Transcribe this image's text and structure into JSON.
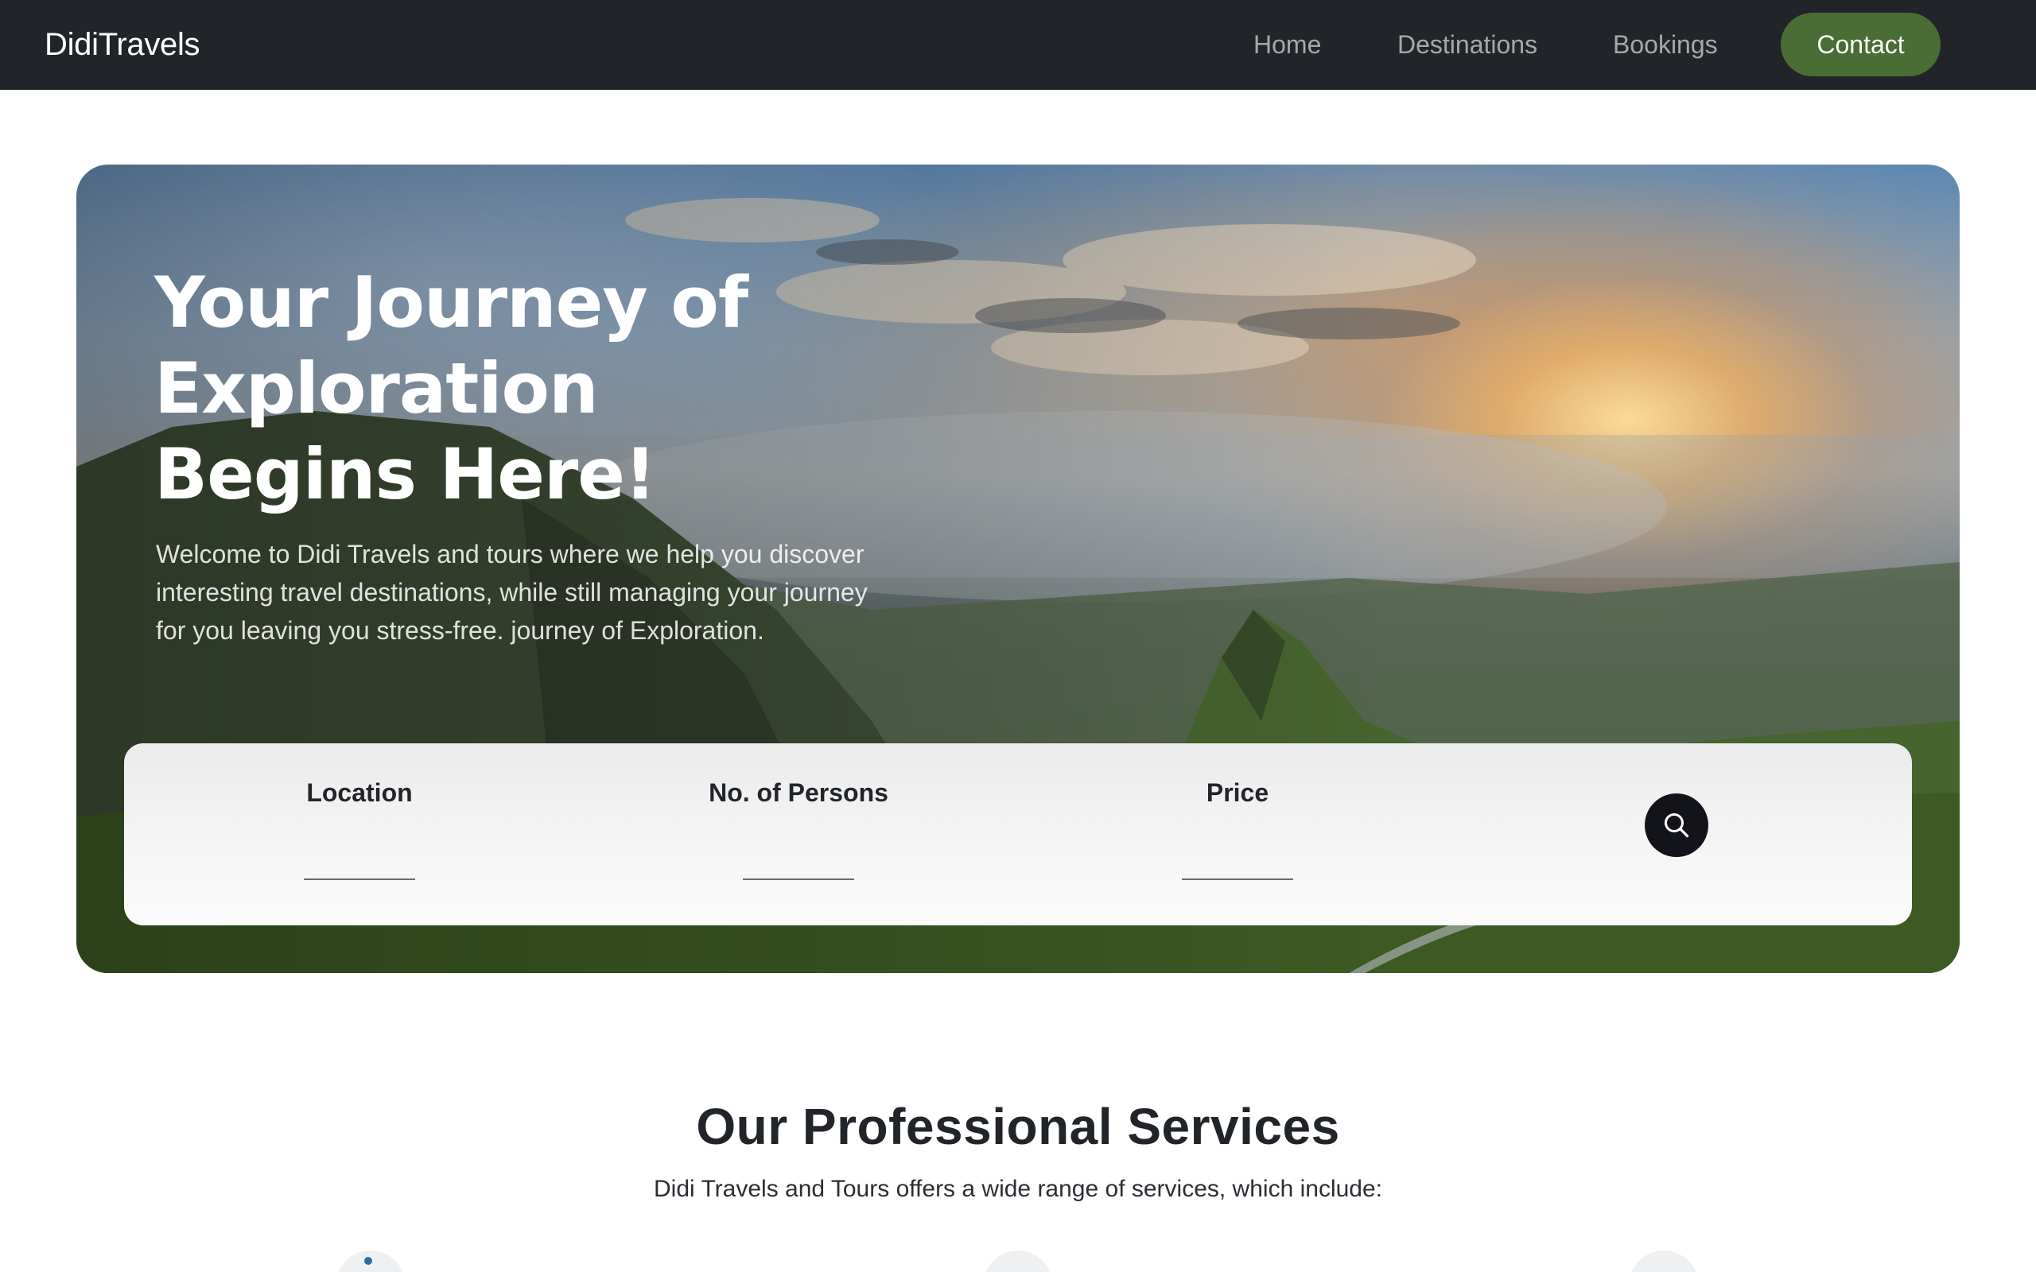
{
  "navbar": {
    "brand": "DidiTravels",
    "links": [
      "Home",
      "Destinations",
      "Bookings"
    ],
    "contact_label": "Contact",
    "colors": {
      "background": "#212529",
      "contact_button": "#4a6c35"
    }
  },
  "hero": {
    "title": "Your Journey of Exploration Begins Here!",
    "description": "Welcome to Didi Travels and tours where we help you discover interesting travel destinations, while still managing your journey for you leaving you stress-free. journey of Exploration."
  },
  "search": {
    "fields": [
      {
        "label": "Location",
        "value": ""
      },
      {
        "label": "No. of Persons",
        "value": ""
      },
      {
        "label": "Price",
        "value": ""
      }
    ],
    "button_icon": "search-icon"
  },
  "services": {
    "title": "Our Professional Services",
    "subtitle": "Didi Travels and Tours offers a wide range of services, which include:"
  }
}
